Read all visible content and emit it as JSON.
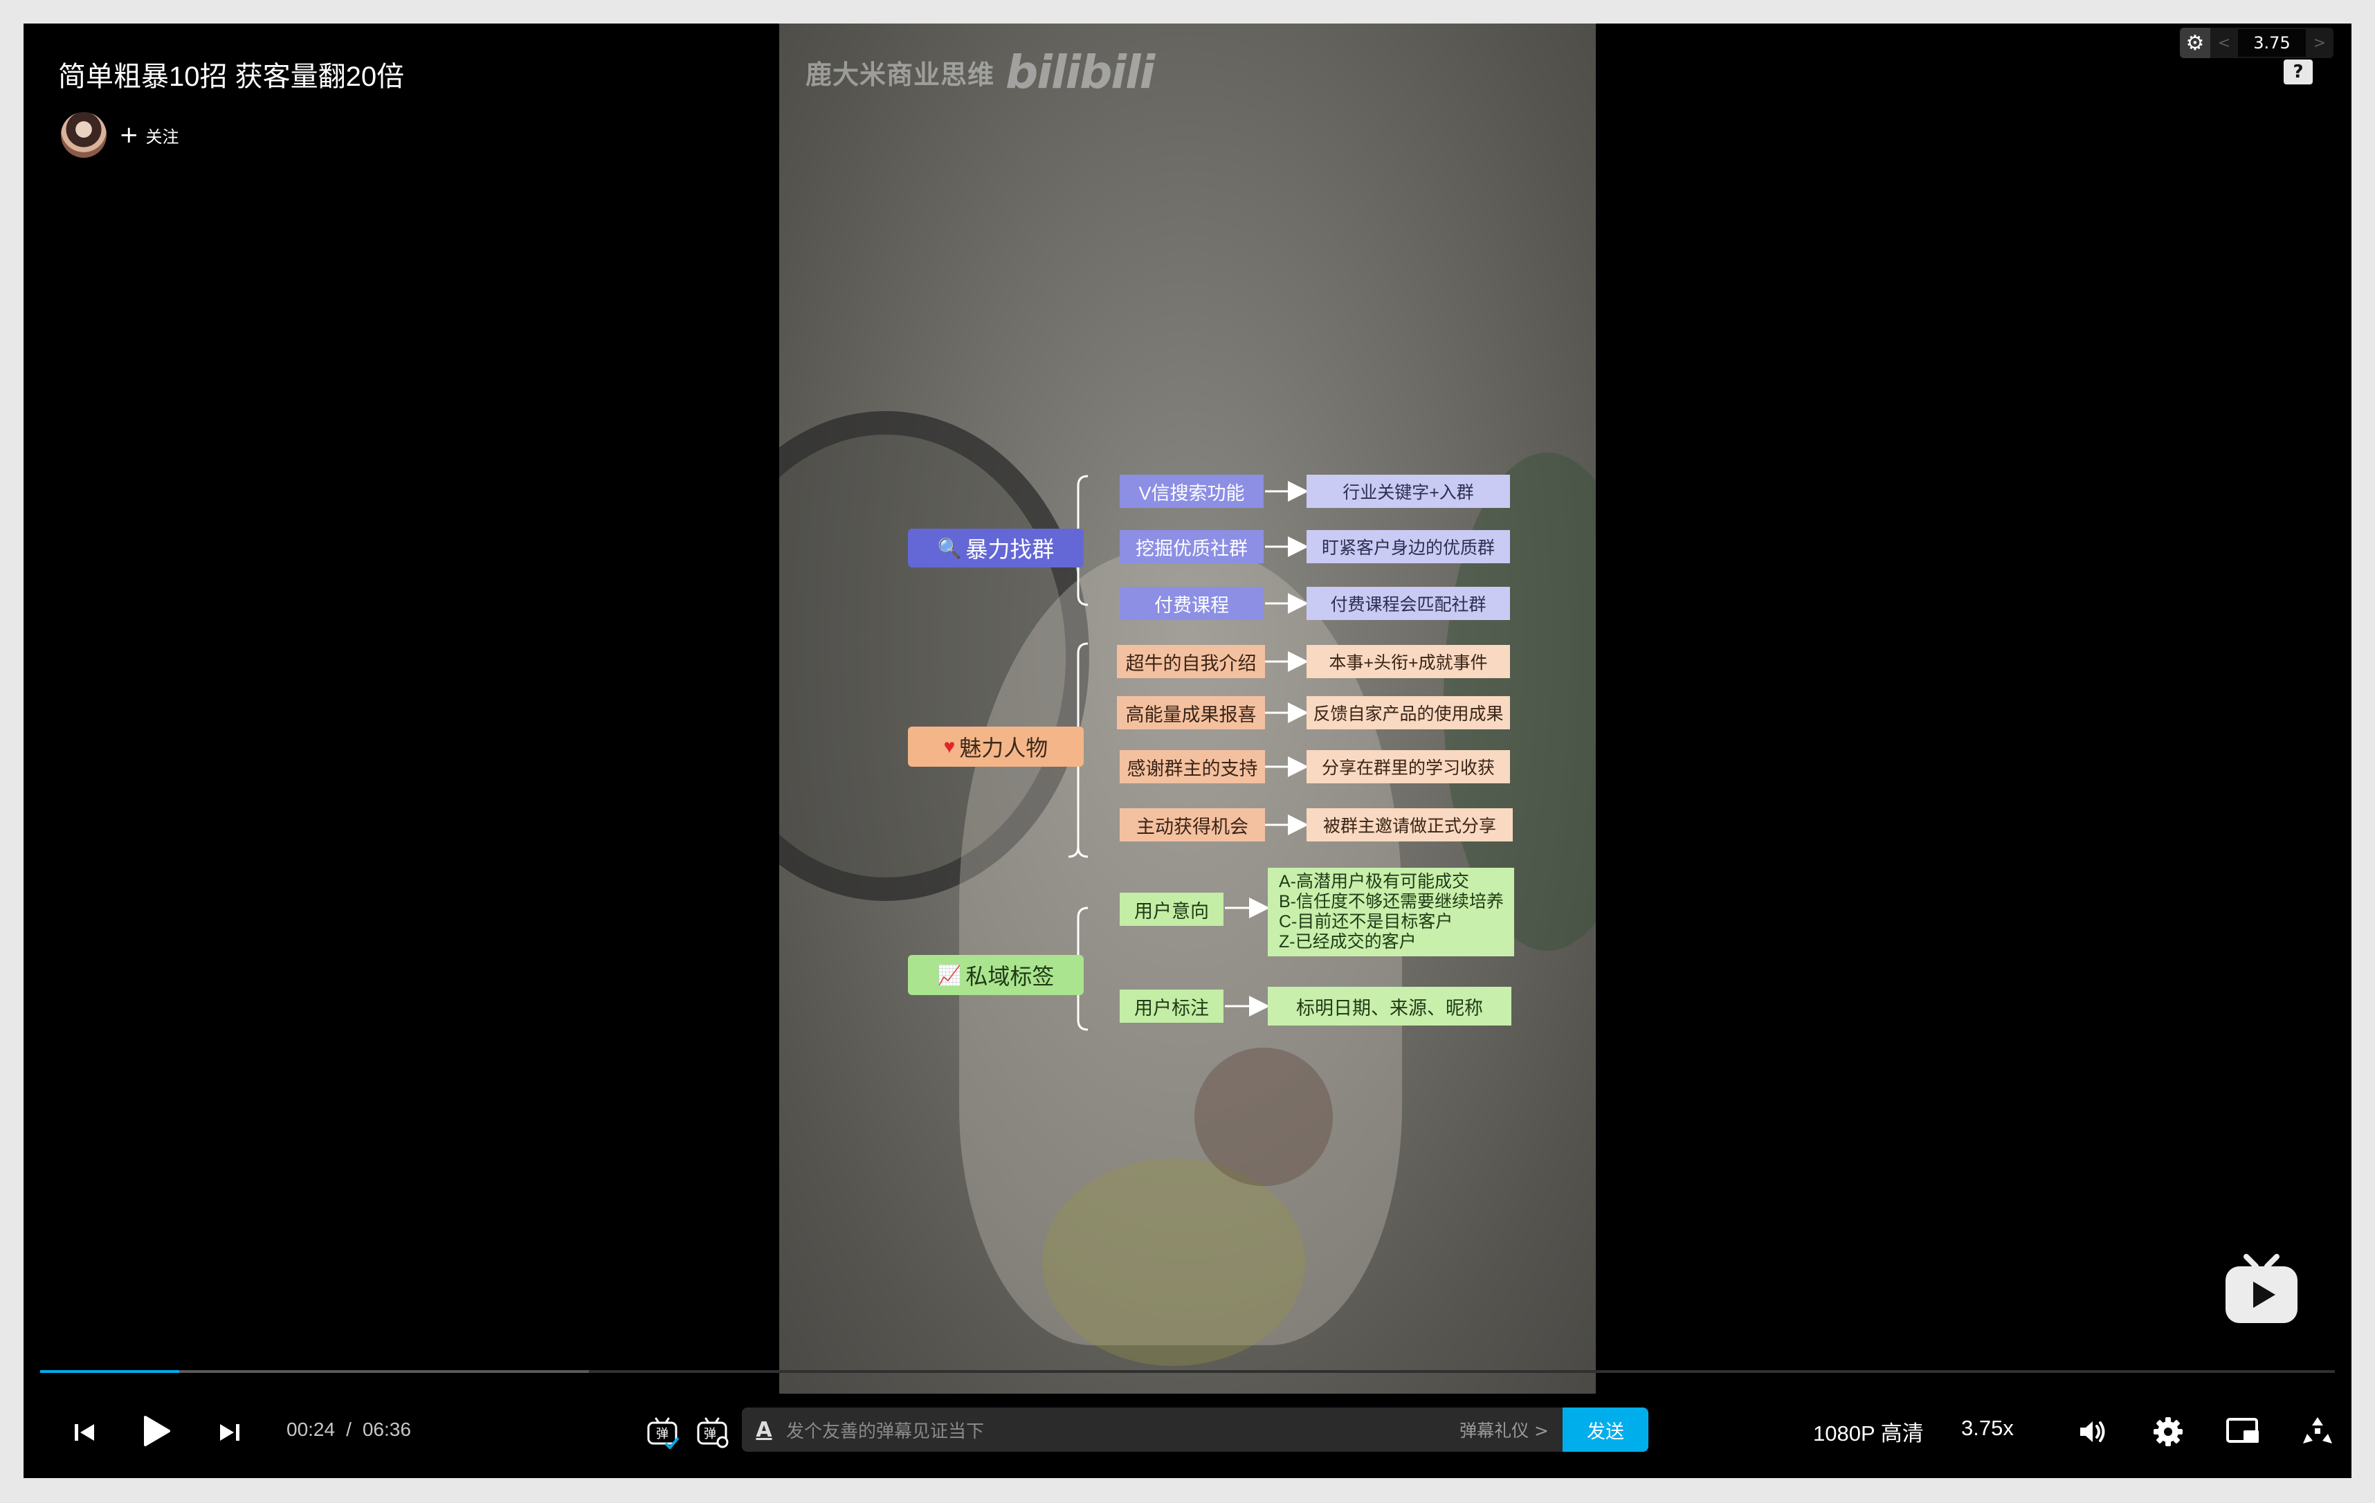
{
  "video": {
    "title": "简单粗暴10招 获客量翻20倍",
    "follow_label": "关注",
    "watermark_channel": "鹿大米商业思维",
    "watermark_logo": "bilibili"
  },
  "overlay": {
    "speed_value": "3.75",
    "speed_prev": "<",
    "speed_next": ">",
    "help_label": "?"
  },
  "mindmap": {
    "groups": [
      {
        "root": "暴力找群",
        "root_icon": "magnifier-emoji",
        "color": "violet",
        "branches": [
          {
            "label": "V信搜索功能",
            "leaf": "行业关键字+入群"
          },
          {
            "label": "挖掘优质社群",
            "leaf": "盯紧客户身边的优质群"
          },
          {
            "label": "付费课程",
            "leaf": "付费课程会匹配社群"
          }
        ]
      },
      {
        "root": "魅力人物",
        "root_icon": "heart-emoji",
        "color": "peach",
        "branches": [
          {
            "label": "超牛的自我介绍",
            "leaf": "本事+头衔+成就事件"
          },
          {
            "label": "高能量成果报喜",
            "leaf": "反馈自家产品的使用成果"
          },
          {
            "label": "感谢群主的支持",
            "leaf": "分享在群里的学习收获"
          },
          {
            "label": "主动获得机会",
            "leaf": "被群主邀请做正式分享"
          }
        ]
      },
      {
        "root": "私域标签",
        "root_icon": "chart-emoji",
        "color": "green",
        "branches": [
          {
            "label": "用户意向",
            "leaf_lines": [
              "A-高潜用户极有可能成交",
              "B-信任度不够还需要继续培养",
              "C-目前还不是目标客户",
              "Z-已经成交的客户"
            ]
          },
          {
            "label": "用户标注",
            "leaf": "标明日期、来源、昵称"
          }
        ]
      }
    ]
  },
  "player": {
    "current_time": "00:24",
    "separator": "/",
    "duration": "06:36",
    "progress_played": 0.0606,
    "progress_buffered": 0.239,
    "danmaku_placeholder": "发个友善的弹幕见证当下",
    "danmaku_etiquette": "弹幕礼仪 >",
    "send_label": "发送",
    "quality": "1080P 高清",
    "speed": "3.75x",
    "danmaku_toggle_glyph": "弹",
    "danmaku_settings_glyph": "弹",
    "format_glyph": "A"
  },
  "colors": {
    "accent": "#00aeec",
    "violet_root": "#6468d6",
    "peach_root": "#f4b689",
    "green_root": "#abe48e"
  }
}
